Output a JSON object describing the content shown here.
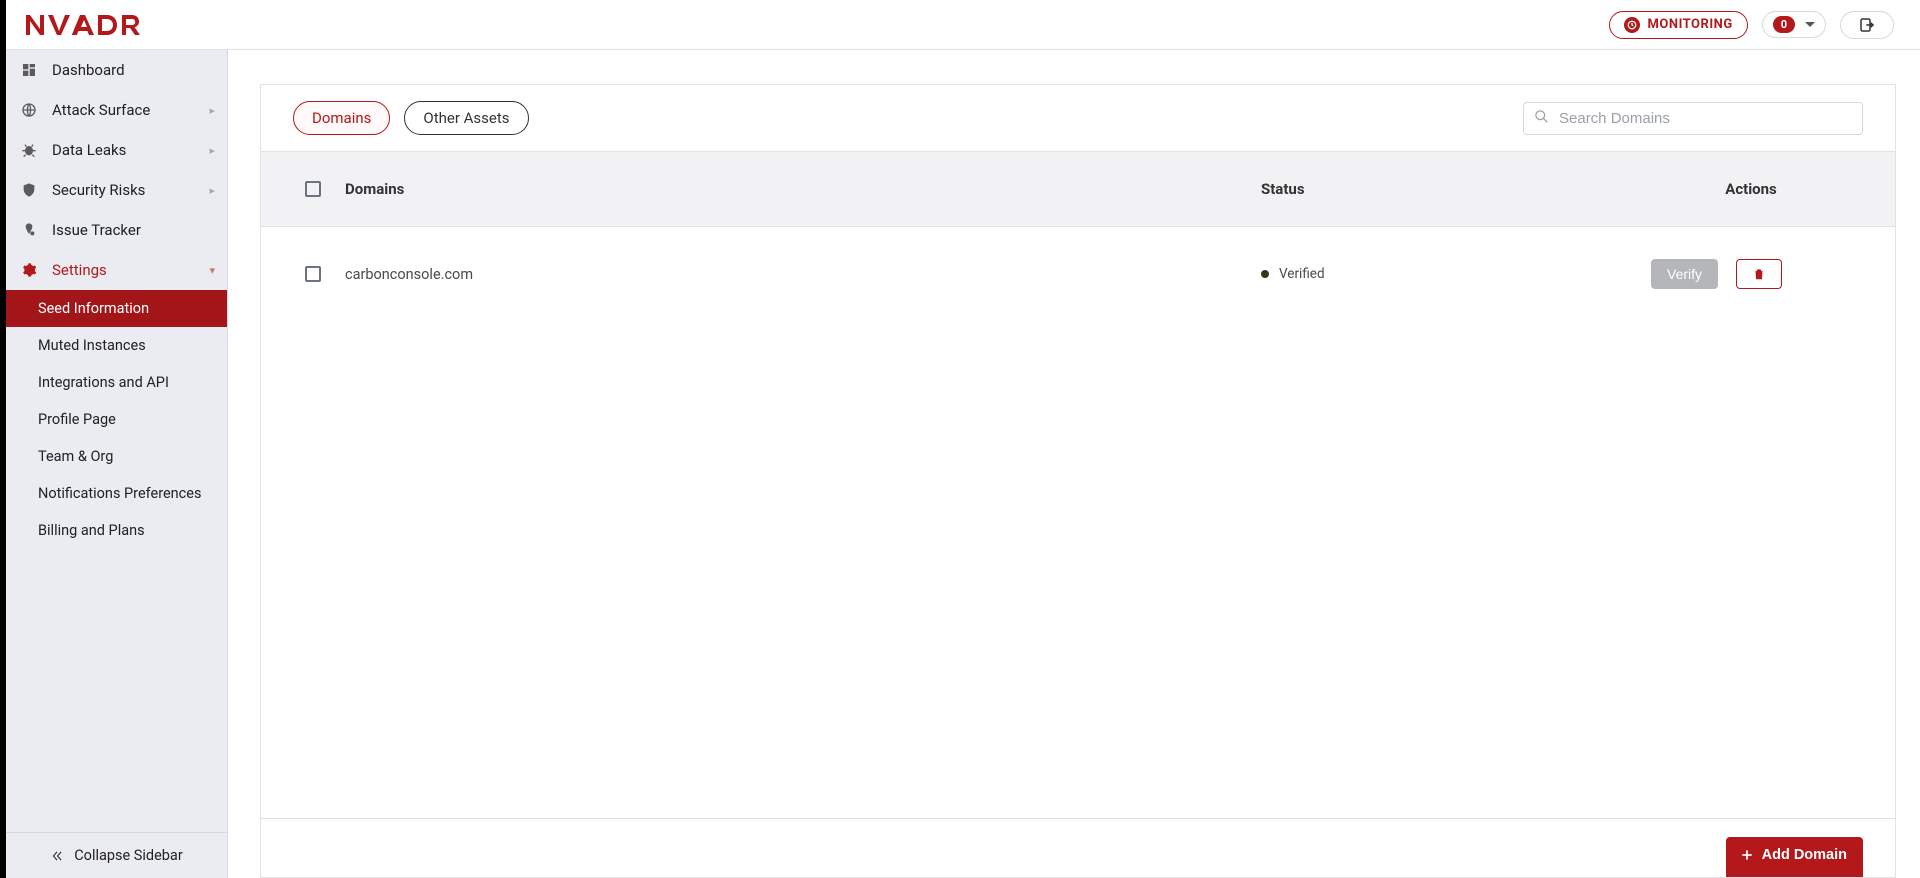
{
  "brand": "NVADR",
  "header": {
    "monitoring_label": "MONITORING",
    "notif_count": "0"
  },
  "sidebar": {
    "items": [
      {
        "label": "Dashboard"
      },
      {
        "label": "Attack Surface"
      },
      {
        "label": "Data Leaks"
      },
      {
        "label": "Security Risks"
      },
      {
        "label": "Issue Tracker"
      },
      {
        "label": "Settings"
      }
    ],
    "settings_sub": [
      {
        "label": "Seed Information"
      },
      {
        "label": "Muted Instances"
      },
      {
        "label": "Integrations and API"
      },
      {
        "label": "Profile Page"
      },
      {
        "label": "Team & Org"
      },
      {
        "label": "Notifications Preferences"
      },
      {
        "label": "Billing and Plans"
      }
    ],
    "collapse_label": "Collapse Sidebar"
  },
  "tabs": {
    "domains": "Domains",
    "other_assets": "Other Assets"
  },
  "search": {
    "placeholder": "Search Domains"
  },
  "table": {
    "head_domain": "Domains",
    "head_status": "Status",
    "head_actions": "Actions",
    "rows": [
      {
        "domain": "carbonconsole.com",
        "status": "Verified",
        "verify_label": "Verify"
      }
    ]
  },
  "buttons": {
    "add_domain": "Add Domain"
  }
}
